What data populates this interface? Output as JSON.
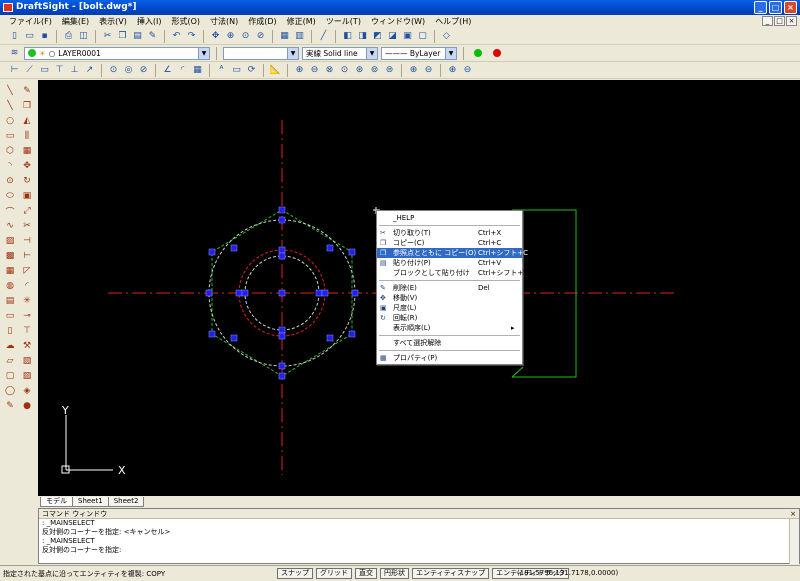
{
  "window": {
    "title": "DraftSight - [bolt.dwg*]",
    "min_glyph": "_",
    "max_glyph": "□",
    "close_glyph": "×"
  },
  "menu": {
    "items": [
      "ファイル(F)",
      "編集(E)",
      "表示(V)",
      "挿入(I)",
      "形式(O)",
      "寸法(N)",
      "作成(D)",
      "修正(M)",
      "ツール(T)",
      "ウィンドウ(W)",
      "ヘルプ(H)"
    ]
  },
  "toolbar2": {
    "layer_value": "LAYER0001",
    "color_value": "",
    "linetype_value": "実線    Solid line",
    "lineweight_value": "——— ByLayer",
    "colors": {
      "green": "#00C000",
      "red": "#E00000"
    }
  },
  "context_menu": {
    "items": [
      {
        "label": "_HELP",
        "shortcut": "",
        "icon": ""
      },
      {
        "label": "切り取り(T)",
        "shortcut": "Ctrl+X",
        "icon": "✂"
      },
      {
        "label": "コピー(C)",
        "shortcut": "Ctrl+C",
        "icon": "❐"
      },
      {
        "label": "参照点とともに コピー(O)",
        "shortcut": "Ctrl+シフト+C",
        "icon": "❐"
      },
      {
        "label": "貼り付け(P)",
        "shortcut": "Ctrl+V",
        "icon": "▤"
      },
      {
        "label": "ブロックとして貼り付け",
        "shortcut": "Ctrl+シフト+V",
        "icon": ""
      },
      {
        "label": "削除(E)",
        "shortcut": "Del",
        "icon": "✎"
      },
      {
        "label": "移動(V)",
        "shortcut": "",
        "icon": "✥"
      },
      {
        "label": "尺度(L)",
        "shortcut": "",
        "icon": "▣"
      },
      {
        "label": "回転(R)",
        "shortcut": "",
        "icon": "↻"
      },
      {
        "label": "表示順序(L)",
        "shortcut": "▸",
        "icon": ""
      },
      {
        "label": "すべて選択解除",
        "shortcut": "",
        "icon": ""
      },
      {
        "label": "プロパティ(P)",
        "shortcut": "",
        "icon": "▦"
      }
    ],
    "selected_index": 3
  },
  "tabs": [
    "モデル",
    "Sheet1",
    "Sheet2"
  ],
  "command_window": {
    "title": "コマンド ウィンドウ",
    "lines": [
      ": _MAINSELECT",
      "反対側のコーナーを指定: <キャンセル>",
      ": _MAINSELECT",
      "反対側のコーナーを指定:"
    ]
  },
  "status": {
    "message": "指定された基点に沿ってエンティティを複製: COPY",
    "buttons": [
      "スナップ",
      "グリッド",
      "直交",
      "円形状",
      "エンティティスナップ",
      "エンティティトラック"
    ],
    "coordinates": "(181.5796,131.7178,0.0000)"
  },
  "axes": {
    "x_label": "X",
    "y_label": "Y"
  }
}
